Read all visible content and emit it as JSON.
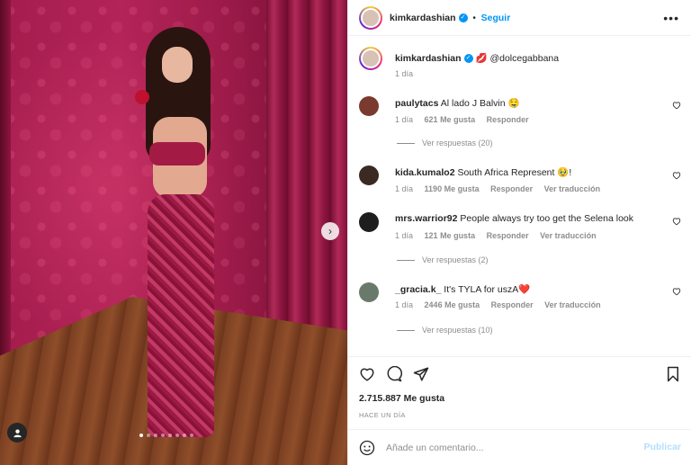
{
  "header": {
    "username": "kimkardashian",
    "follow_label": "Seguir",
    "separator": "•",
    "more_icon": "ellipsis-icon"
  },
  "caption": {
    "username": "kimkardashian",
    "text": "💋 @dolcegabbana",
    "time": "1 día"
  },
  "comments": [
    {
      "username": "paulytacs",
      "text": "Al lado J Balvin 🤤",
      "time": "1 día",
      "likes": "621 Me gusta",
      "reply_label": "Responder",
      "translate_label": "",
      "replies_label": "Ver respuestas (20)"
    },
    {
      "username": "kida.kumalo2",
      "text": "South Africa Represent 🥹!",
      "time": "1 día",
      "likes": "1190 Me gusta",
      "reply_label": "Responder",
      "translate_label": "Ver traducción",
      "replies_label": ""
    },
    {
      "username": "mrs.warrior92",
      "text": "People always try too get the Selena look",
      "time": "1 día",
      "likes": "121 Me gusta",
      "reply_label": "Responder",
      "translate_label": "Ver traducción",
      "replies_label": "Ver respuestas (2)"
    },
    {
      "username": "_gracia.k_",
      "text": "It's TYLA for uszA❤️",
      "time": "1 día",
      "likes": "2446 Me gusta",
      "reply_label": "Responder",
      "translate_label": "Ver traducción",
      "replies_label": "Ver respuestas (10)"
    }
  ],
  "actions": {
    "likes": "2.715.887 Me gusta",
    "time": "HACE UN DÍA"
  },
  "comment_box": {
    "placeholder": "Añade un comentario...",
    "post_label": "Publicar"
  },
  "carousel": {
    "count": 8,
    "active": 0
  },
  "colors": {
    "accent": "#0095f6",
    "text": "#262626",
    "muted": "#8e8e8e"
  }
}
